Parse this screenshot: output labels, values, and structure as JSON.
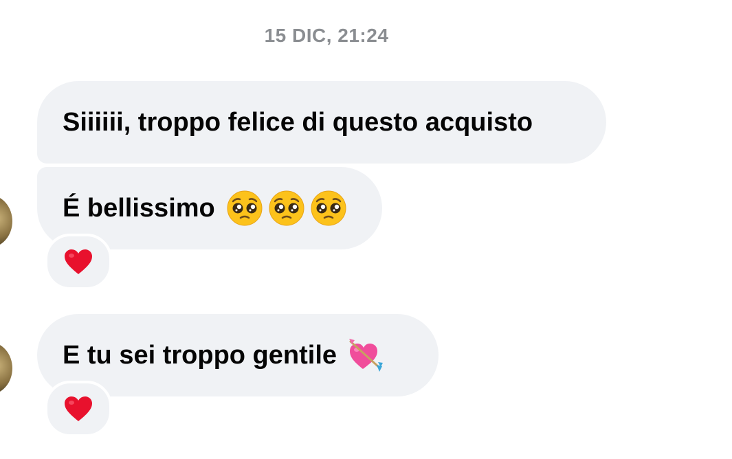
{
  "conversation": {
    "timestamp": "15 DIC, 21:24",
    "messages": [
      {
        "text": "Siiiiii, troppo felice di questo acquisto",
        "emojis": [],
        "reaction": null
      },
      {
        "text": "É bellissimo",
        "emojis": [
          "pleading-face-icon",
          "pleading-face-icon",
          "pleading-face-icon"
        ],
        "reaction": "heart-icon"
      },
      {
        "text": "E tu sei troppo gentile",
        "emojis": [
          "heart-with-arrow-icon"
        ],
        "reaction": "heart-icon"
      }
    ]
  },
  "colors": {
    "bubble_bg": "#f0f2f5",
    "text": "#050505",
    "timestamp": "#8a8d91",
    "heart": "#e8112d"
  }
}
